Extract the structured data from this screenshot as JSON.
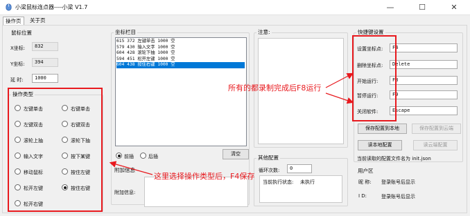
{
  "window": {
    "title": "小梁鼠标连点器----小梁 V1.7",
    "minimize": "—",
    "maximize": "☐",
    "close": "✕",
    "icon": "mouse-icon"
  },
  "tabs": [
    {
      "label": "操作页"
    },
    {
      "label": "关于页"
    }
  ],
  "mouse_pos": {
    "title": "鼠标位置",
    "x_label": "X坐标:",
    "x_value": "832",
    "y_label": "Y坐标:",
    "y_value": "394",
    "delay_label": "延  时:",
    "delay_value": "1000"
  },
  "op_types": {
    "title": "操作类型",
    "options": [
      {
        "label": "左键单击",
        "selected": false
      },
      {
        "label": "右键单击",
        "selected": false
      },
      {
        "label": "左键双击",
        "selected": false
      },
      {
        "label": "右键双击",
        "selected": false
      },
      {
        "label": "滚轮上抽",
        "selected": false
      },
      {
        "label": "滚轮下抽",
        "selected": false
      },
      {
        "label": "输入文字",
        "selected": false
      },
      {
        "label": "按下某键",
        "selected": false
      },
      {
        "label": "移动鼠标",
        "selected": false
      },
      {
        "label": "按住左键",
        "selected": false
      },
      {
        "label": "松开左键",
        "selected": false
      },
      {
        "label": "按住右键",
        "selected": true
      },
      {
        "label": "松开右键",
        "selected": false
      }
    ]
  },
  "coords": {
    "title": "坐标栏目",
    "rows": [
      {
        "text": "615 372 左键单击 1000 空",
        "selected": false
      },
      {
        "text": "579 430 输入文字 1000 空",
        "selected": false
      },
      {
        "text": "604 428 滚轮下抽 1000 空",
        "selected": false
      },
      {
        "text": "594 451 松开左键 1000 空",
        "selected": false
      },
      {
        "text": "604 438 按住右键 1000 空",
        "selected": true
      }
    ],
    "radio_front": "前插",
    "radio_back": "后插",
    "clear_button": "清空"
  },
  "extra": {
    "title": "附加信息",
    "label": "附加信息:",
    "value": ""
  },
  "notes": {
    "title": "注意:"
  },
  "other": {
    "title": "其他配置",
    "loop_label": "循环次数:",
    "loop_value": "0",
    "status_label": "当前执行状态:",
    "status_value": "未执行"
  },
  "hotkeys": {
    "title": "快捷键设置",
    "items": [
      {
        "label": "设置坐标点:",
        "value": "F4"
      },
      {
        "label": "删除坐标点:",
        "value": "Delete"
      },
      {
        "label": "开始运行:",
        "value": "F8"
      },
      {
        "label": "暂停运行:",
        "value": "F9"
      },
      {
        "label": "关闭软件:",
        "value": "Escape"
      }
    ],
    "save_local": "保存配置到本地",
    "save_cloud": "保存配置到云端",
    "read_local": "读本地配置",
    "read_cloud": "读云端配置",
    "config_file_text": "当前读取的配置文件名为 init.json"
  },
  "user": {
    "title": "用户区",
    "nick_label": "昵  称:",
    "nick_value": "登录账号后显示",
    "id_label": "I D:",
    "id_value": "登录账号后显示"
  },
  "annotations": {
    "hotkey_note": "所有的都录制完成后F8运行",
    "optype_note": "这里选择操作类型后，F4保存"
  },
  "colors": {
    "annotation_red": "#e8191e",
    "selection_blue": "#0078d7"
  }
}
